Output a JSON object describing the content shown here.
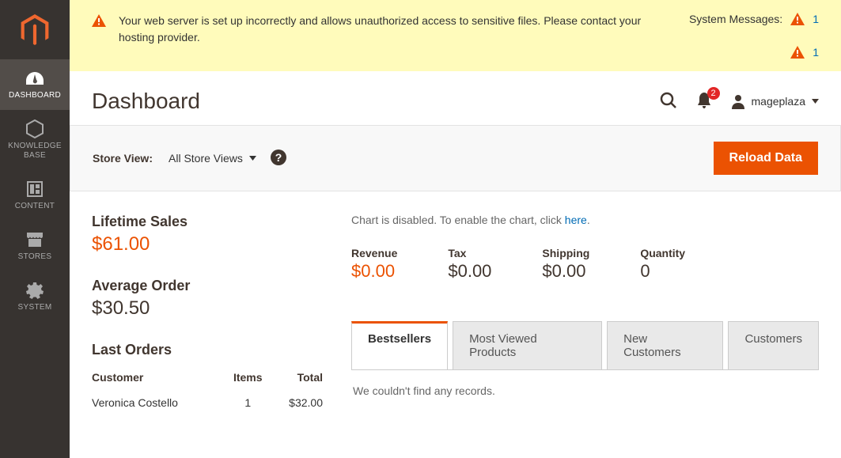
{
  "nav": {
    "items": [
      {
        "label": "DASHBOARD"
      },
      {
        "label": "KNOWLEDGE BASE"
      },
      {
        "label": "CONTENT"
      },
      {
        "label": "STORES"
      },
      {
        "label": "SYSTEM"
      }
    ]
  },
  "systemMessages": {
    "text": "Your web server is set up incorrectly and allows unauthorized access to sensitive files. Please contact your hosting provider.",
    "label": "System Messages:",
    "counts": [
      "1",
      "1"
    ]
  },
  "header": {
    "title": "Dashboard",
    "notifications": "2",
    "user": "mageplaza"
  },
  "toolbar": {
    "storeViewLabel": "Store View:",
    "currentView": "All Store Views",
    "reloadBtn": "Reload Data"
  },
  "stats": {
    "lifetimeLabel": "Lifetime Sales",
    "lifetimeValue": "$61.00",
    "avgLabel": "Average Order",
    "avgValue": "$30.50"
  },
  "lastOrders": {
    "title": "Last Orders",
    "cols": [
      "Customer",
      "Items",
      "Total"
    ],
    "rows": [
      {
        "customer": "Veronica Costello",
        "items": "1",
        "total": "$32.00"
      }
    ]
  },
  "chartNote": {
    "prefix": "Chart is disabled. To enable the chart, click ",
    "link": "here",
    "suffix": "."
  },
  "metrics": {
    "revenue": {
      "label": "Revenue",
      "value": "$0.00"
    },
    "tax": {
      "label": "Tax",
      "value": "$0.00"
    },
    "shipping": {
      "label": "Shipping",
      "value": "$0.00"
    },
    "quantity": {
      "label": "Quantity",
      "value": "0"
    }
  },
  "tabs": {
    "items": [
      "Bestsellers",
      "Most Viewed Products",
      "New Customers",
      "Customers"
    ],
    "empty": "We couldn't find any records."
  }
}
